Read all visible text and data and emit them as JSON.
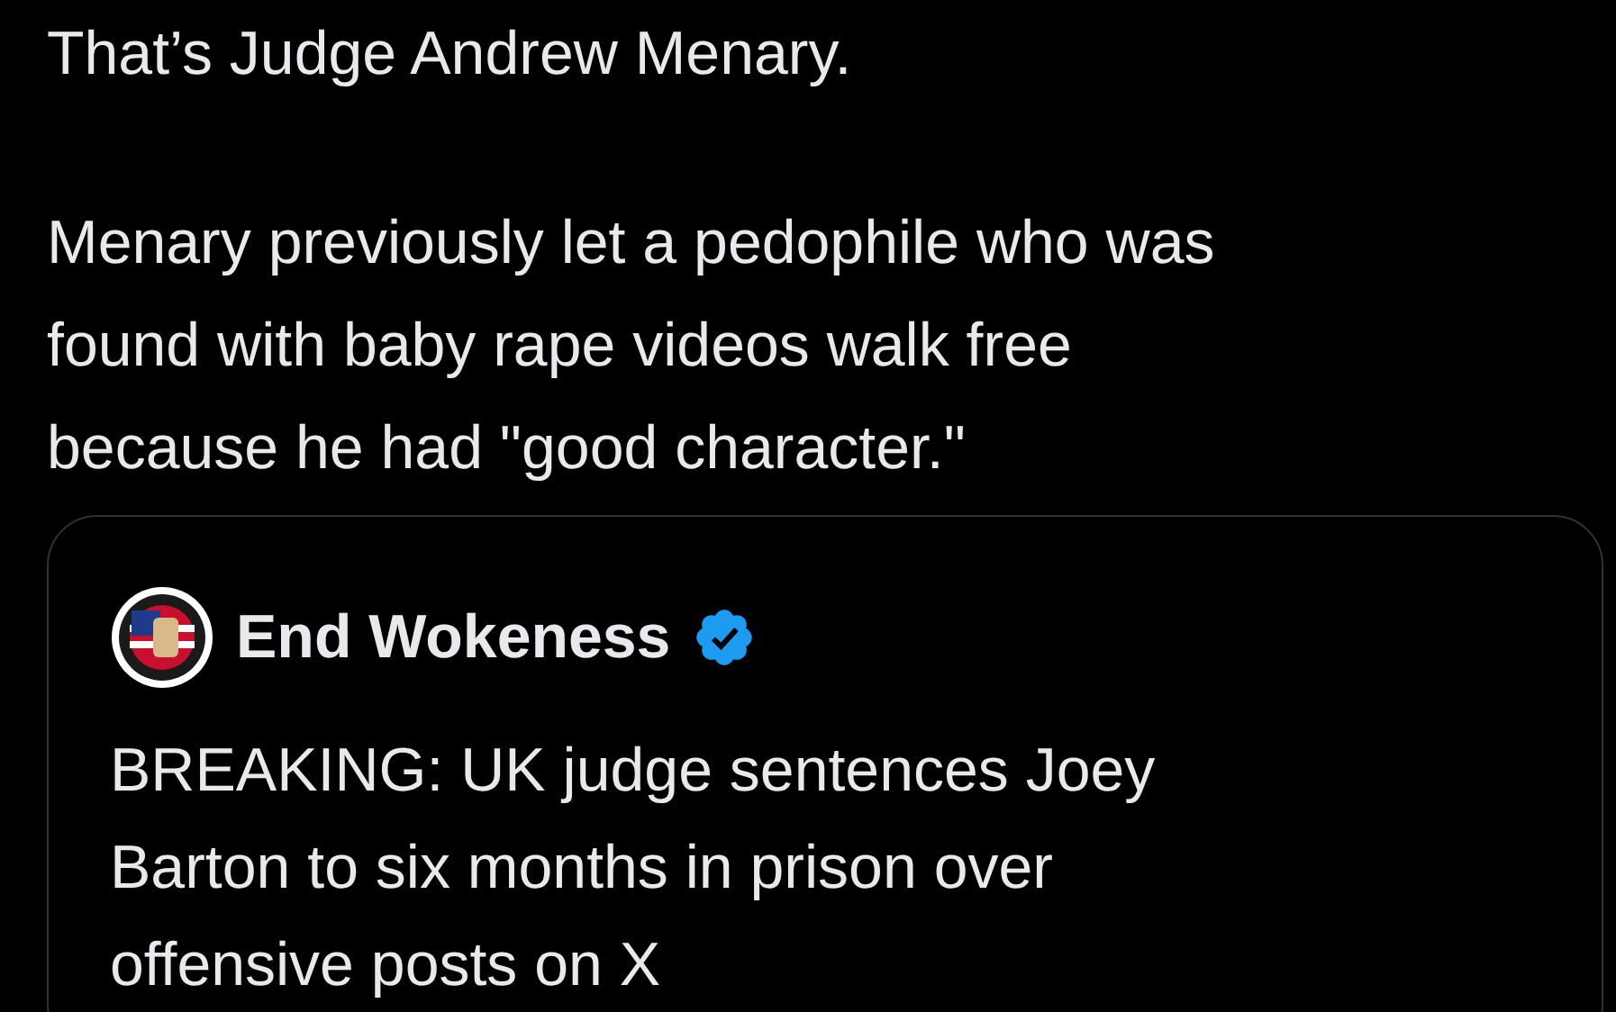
{
  "post": {
    "paragraphs": [
      [
        "That’s Judge Andrew Menary."
      ],
      [
        "Menary previously let a pedophile who was",
        "found with baby rape videos walk free",
        "because he had \"good character.\""
      ]
    ]
  },
  "quoted_post": {
    "author": "End Wokeness",
    "verified": true,
    "lines": [
      "BREAKING: UK judge sentences Joey",
      "Barton to six months in prison over",
      "offensive posts on X"
    ]
  }
}
